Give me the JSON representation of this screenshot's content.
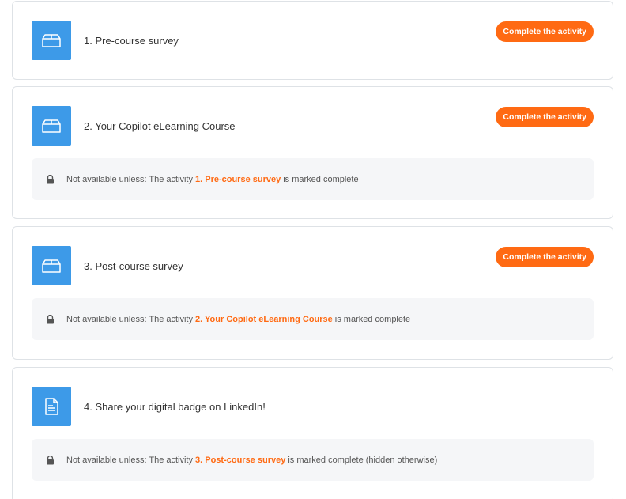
{
  "activities": [
    {
      "icon": "box-icon",
      "name": "1. Pre-course survey",
      "button_label": "Complete the activity"
    },
    {
      "icon": "box-icon",
      "name": "2. Your Copilot eLearning Course",
      "button_label": "Complete the activity",
      "restriction": {
        "prefix": "Not available unless: The activity",
        "link": "1. Pre-course survey",
        "suffix": "is marked complete"
      }
    },
    {
      "icon": "box-icon",
      "name": "3. Post-course survey",
      "button_label": "Complete the activity",
      "restriction": {
        "prefix": "Not available unless: The activity",
        "link": "2. Your Copilot eLearning Course",
        "suffix": "is marked complete"
      }
    },
    {
      "icon": "document-icon",
      "name": "4. Share your digital badge on LinkedIn!",
      "restriction": {
        "prefix": "Not available unless: The activity",
        "link": "3. Post-course survey",
        "suffix": "is marked complete (hidden otherwise)"
      }
    }
  ],
  "colors": {
    "accent": "#ff6a13",
    "icon_tile": "#3d9ae8",
    "restriction_bg": "#f5f6f8",
    "border": "#dee2e6"
  }
}
